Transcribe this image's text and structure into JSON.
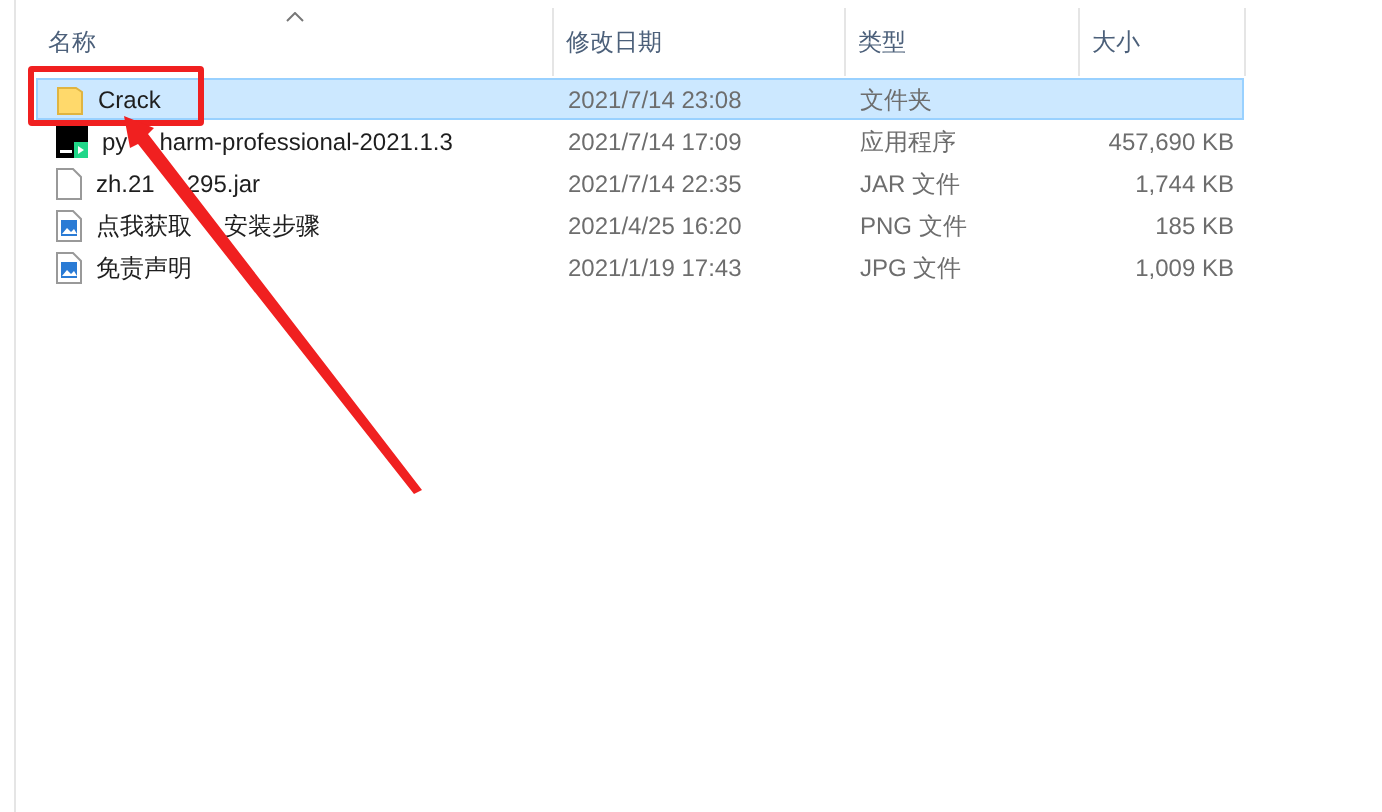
{
  "columns": [
    {
      "label": "名称",
      "sorted": true
    },
    {
      "label": "修改日期",
      "sorted": false
    },
    {
      "label": "类型",
      "sorted": false
    },
    {
      "label": "大小",
      "sorted": false
    }
  ],
  "rows": [
    {
      "kind": "folder",
      "name_parts": [
        "Crack"
      ],
      "date": "2021/7/14 23:08",
      "type": "文件夹",
      "size": "",
      "selected": true,
      "circled": true
    },
    {
      "kind": "app",
      "name_parts": [
        "py",
        "harm-professional-2021.1.3"
      ],
      "date": "2021/7/14 17:09",
      "type": "应用程序",
      "size": "457,690 KB",
      "selected": false,
      "circled": false
    },
    {
      "kind": "file",
      "name_parts": [
        "zh.21",
        "295.jar"
      ],
      "date": "2021/7/14 22:35",
      "type": "JAR 文件",
      "size": "1,744 KB",
      "selected": false,
      "circled": false
    },
    {
      "kind": "image",
      "name_parts": [
        "点我获取",
        "安装步骤"
      ],
      "date": "2021/4/25 16:20",
      "type": "PNG 文件",
      "size": "185 KB",
      "selected": false,
      "circled": false
    },
    {
      "kind": "image",
      "name_parts": [
        "免责声明"
      ],
      "date": "2021/1/19 17:43",
      "type": "JPG 文件",
      "size": "1,009 KB",
      "selected": false,
      "circled": false
    }
  ]
}
